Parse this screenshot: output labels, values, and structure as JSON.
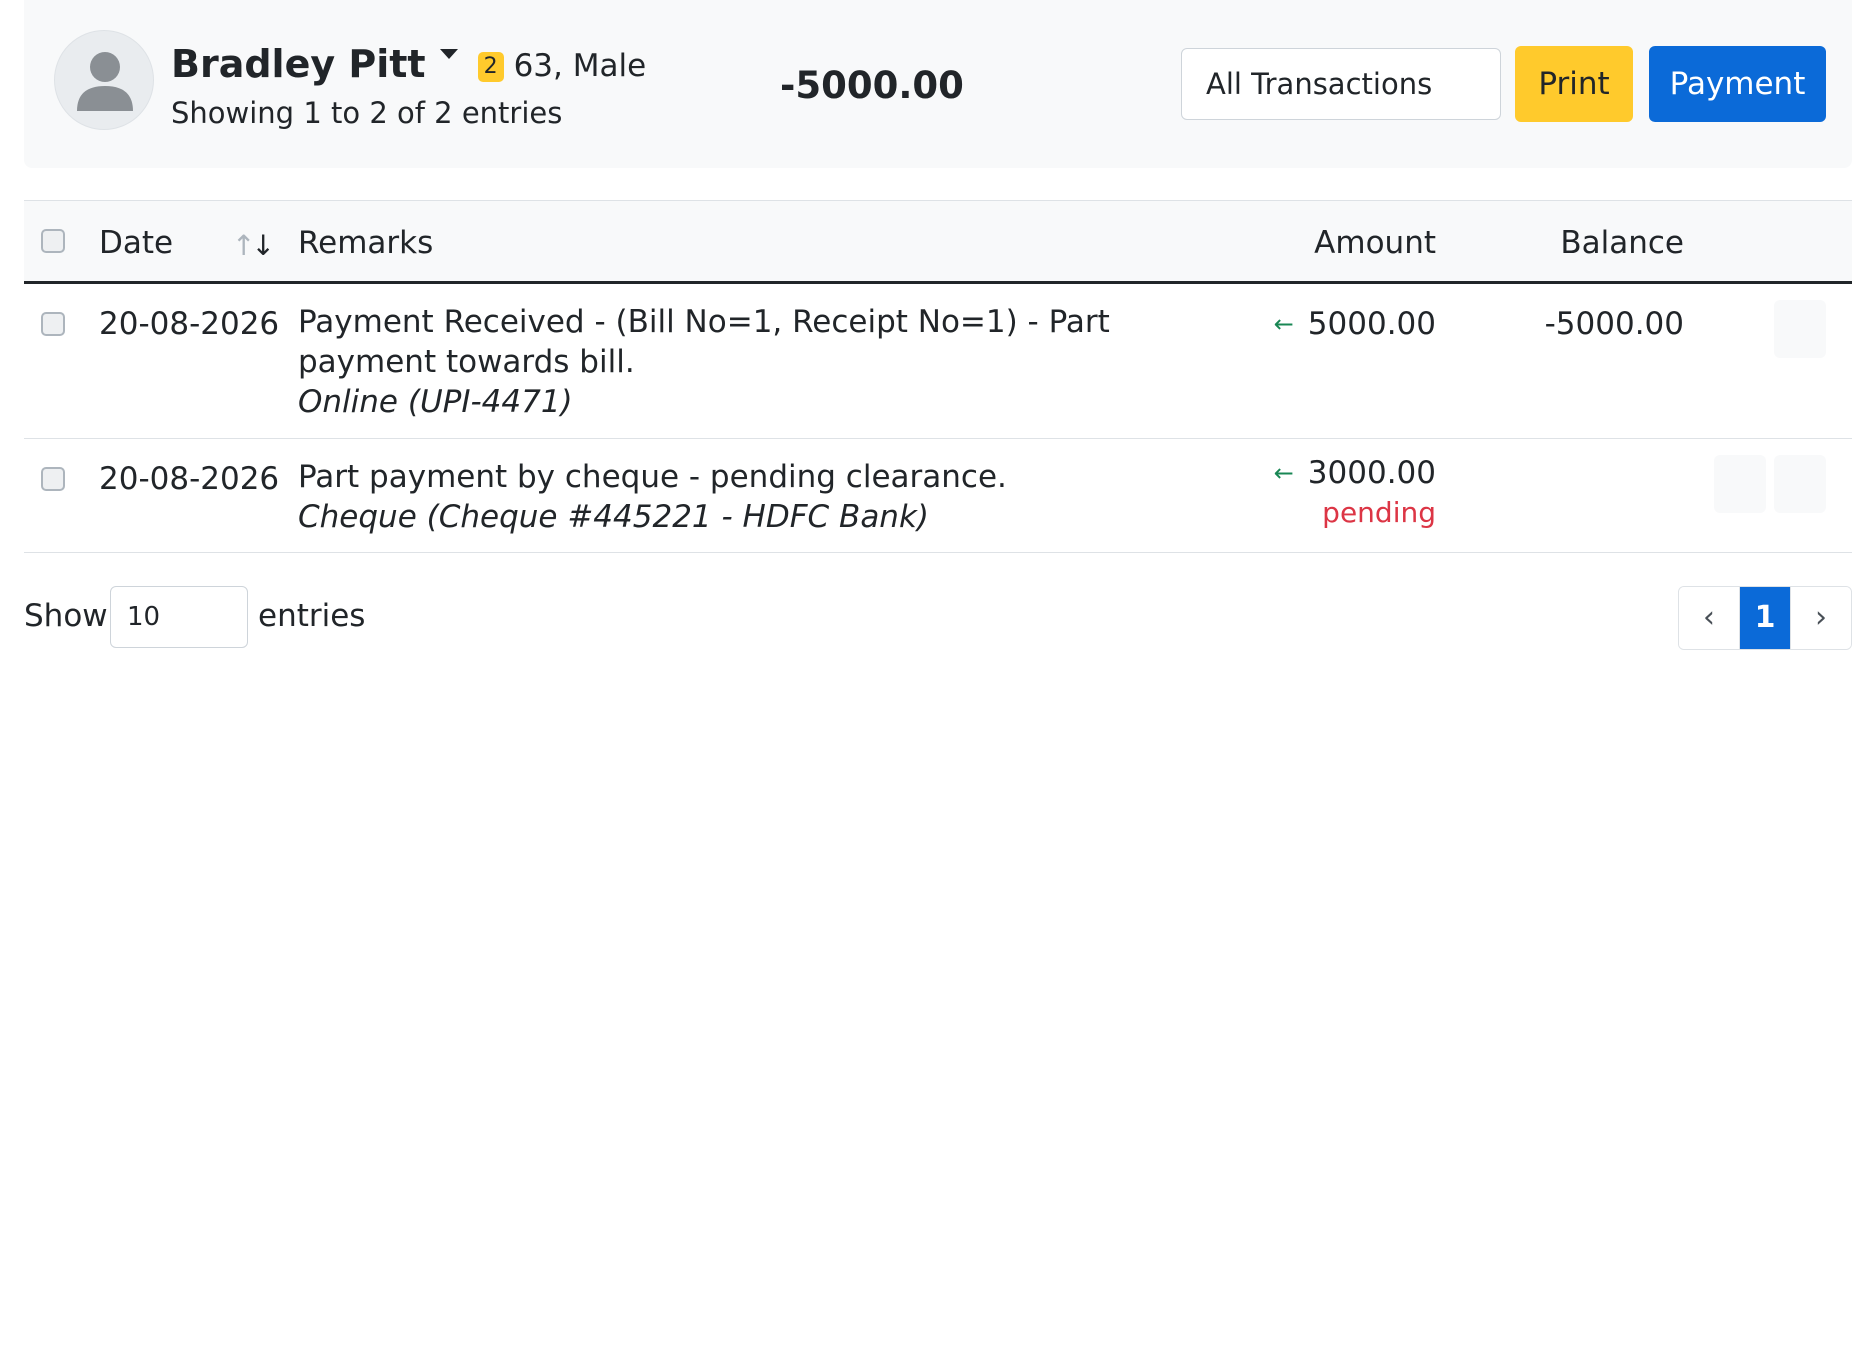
{
  "patient": {
    "name": "Bradley Pitt",
    "badge": "2",
    "age_sex": "63, Male",
    "entries_info": "Showing 1 to 2 of 2 entries",
    "total_balance": "-5000.00"
  },
  "toolbar": {
    "filter_value": "All Transactions",
    "print_label": "Print",
    "payment_label": "Payment"
  },
  "table": {
    "columns": {
      "date": "Date",
      "remarks": "Remarks",
      "amount": "Amount",
      "balance": "Balance"
    },
    "rows": [
      {
        "date": "20-08-2026",
        "remarks": "Payment Received - (Bill No=1, Receipt No=1) - Part payment towards bill.",
        "mode": "Online (UPI-4471)",
        "amount": "5000.00",
        "status": "",
        "balance": "-5000.00"
      },
      {
        "date": "20-08-2026",
        "remarks": "Part payment by cheque - pending clearance.",
        "mode": "Cheque (Cheque #445221 - HDFC Bank)",
        "amount": "3000.00",
        "status": "pending",
        "balance": ""
      }
    ]
  },
  "footer": {
    "show_label": "Show",
    "page_size": "10",
    "entries_label": "entries",
    "current_page": "1"
  },
  "colors": {
    "primary": "#0b6ad8",
    "warning": "#ffca2c",
    "success": "#198754",
    "danger": "#dc3545"
  },
  "icons": {
    "avatar": "user-silhouette-icon",
    "caret": "caret-down-icon",
    "sort": "sort-arrows-icon",
    "incoming": "arrow-left-icon",
    "prev": "chevron-left-icon",
    "next": "chevron-right-icon"
  }
}
